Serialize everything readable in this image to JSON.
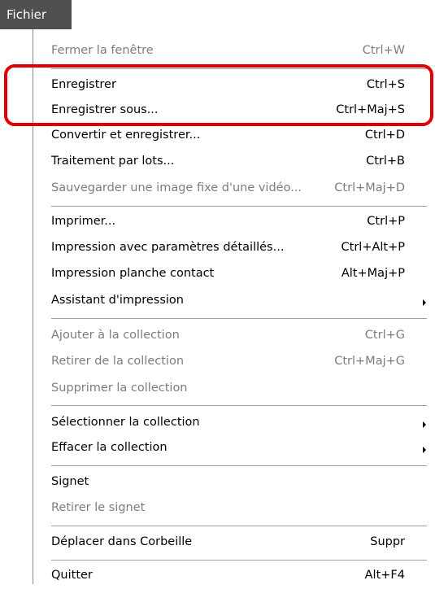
{
  "menubar": {
    "tab_label": "Fichier"
  },
  "menu": {
    "items": [
      {
        "label": "Fermer la fenêtre",
        "shortcut": "Ctrl+W"
      },
      {
        "label": "Enregistrer",
        "shortcut": "Ctrl+S"
      },
      {
        "label": "Enregistrer sous...",
        "shortcut": "Ctrl+Maj+S"
      },
      {
        "label": "Convertir et enregistrer...",
        "shortcut": "Ctrl+D"
      },
      {
        "label": "Traitement par lots...",
        "shortcut": "Ctrl+B"
      },
      {
        "label": "Sauvegarder une image fixe d'une vidéo...",
        "shortcut": "Ctrl+Maj+D"
      },
      {
        "label": "Imprimer...",
        "shortcut": "Ctrl+P"
      },
      {
        "label": "Impression avec paramètres détaillés...",
        "shortcut": "Ctrl+Alt+P"
      },
      {
        "label": "Impression planche contact",
        "shortcut": "Alt+Maj+P"
      },
      {
        "label": "Assistant d'impression",
        "shortcut": ""
      },
      {
        "label": "Ajouter à la collection",
        "shortcut": "Ctrl+G"
      },
      {
        "label": "Retirer de la collection",
        "shortcut": "Ctrl+Maj+G"
      },
      {
        "label": "Supprimer la collection",
        "shortcut": ""
      },
      {
        "label": "Sélectionner la collection",
        "shortcut": ""
      },
      {
        "label": "Effacer la collection",
        "shortcut": ""
      },
      {
        "label": "Signet",
        "shortcut": ""
      },
      {
        "label": "Retirer le signet",
        "shortcut": ""
      },
      {
        "label": "Déplacer dans Corbeille",
        "shortcut": "Suppr"
      },
      {
        "label": "Quitter",
        "shortcut": "Alt+F4"
      }
    ]
  },
  "highlight_color": "#e00000"
}
